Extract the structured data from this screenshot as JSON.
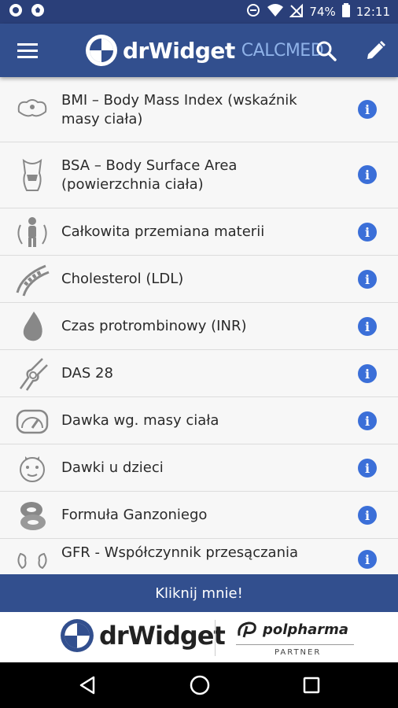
{
  "status": {
    "battery": "74%",
    "time": "12:11"
  },
  "appbar": {
    "brand": "drWidget",
    "brand_sub": "CALCMED"
  },
  "list": [
    {
      "label": "BMI – Body Mass Index (wskaźnik masy ciała)",
      "icon": "body-scale-icon"
    },
    {
      "label": "BSA – Body Surface Area (powierzchnia ciała)",
      "icon": "torso-icon"
    },
    {
      "label": "Całkowita przemiana materii",
      "icon": "person-cycle-icon"
    },
    {
      "label": "Cholesterol (LDL)",
      "icon": "artery-icon"
    },
    {
      "label": "Czas protrombinowy (INR)",
      "icon": "blood-drop-icon"
    },
    {
      "label": "DAS 28",
      "icon": "joint-icon"
    },
    {
      "label": "Dawka wg. masy ciała",
      "icon": "gauge-icon"
    },
    {
      "label": "Dawki u dzieci",
      "icon": "baby-face-icon"
    },
    {
      "label": "Formuła Ganzoniego",
      "icon": "blood-cells-icon"
    },
    {
      "label": "GFR - Współczynnik przesączania",
      "icon": "kidneys-icon"
    }
  ],
  "info_glyph": "i",
  "cta": {
    "label": "Kliknij mnie!"
  },
  "partner": {
    "brand": "drWidget",
    "company": "polpharma",
    "tag": "PARTNER"
  }
}
